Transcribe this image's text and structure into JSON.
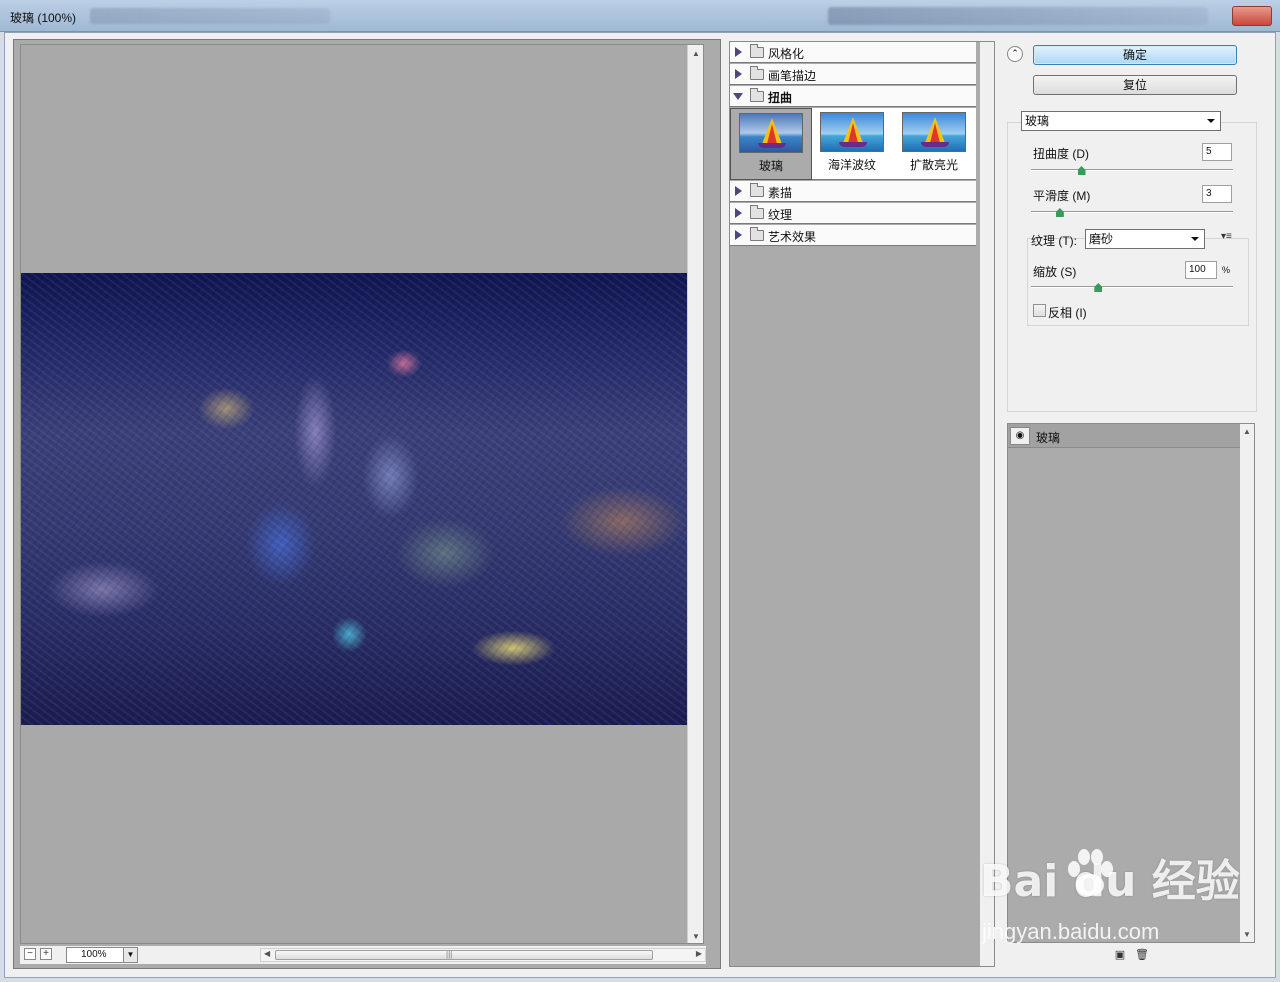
{
  "window": {
    "title": "玻璃 (100%)"
  },
  "buttons": {
    "ok": "确定",
    "reset": "复位"
  },
  "preview": {
    "zoom": "100%",
    "zoom_out": "−",
    "zoom_in": "+"
  },
  "gallery": {
    "categories_before": [
      {
        "label": "风格化",
        "open": false
      },
      {
        "label": "画笔描边",
        "open": false
      }
    ],
    "open_category": {
      "label": "扭曲",
      "open": true
    },
    "thumbnails": [
      {
        "label": "玻璃",
        "selected": true
      },
      {
        "label": "海洋波纹",
        "selected": false
      },
      {
        "label": "扩散亮光",
        "selected": false
      }
    ],
    "categories_after": [
      {
        "label": "素描",
        "open": false
      },
      {
        "label": "纹理",
        "open": false
      },
      {
        "label": "艺术效果",
        "open": false
      }
    ]
  },
  "settings": {
    "filter_select": "玻璃",
    "distortion": {
      "label": "扭曲度 (D)",
      "value": "5",
      "level": 5,
      "max": 20
    },
    "smoothness": {
      "label": "平滑度 (M)",
      "value": "3",
      "level": 3,
      "max": 15
    },
    "texture": {
      "label": "纹理 (T):",
      "value": "磨砂"
    },
    "scaling": {
      "label": "缩放 (S)",
      "value": "100",
      "unit": "%",
      "level": 100,
      "min": 50,
      "max": 200
    },
    "invert": {
      "label": "反相 (I)",
      "checked": false
    }
  },
  "layers": {
    "items": [
      {
        "label": "玻璃",
        "visible": true
      }
    ]
  },
  "watermark": {
    "brand": "Bai du 经验",
    "url": "jingyan.baidu.com"
  },
  "colors": {
    "primary_button": "#a9d8f5",
    "slider_knob": "#3a9a5a",
    "panel_bg": "#ababab"
  }
}
